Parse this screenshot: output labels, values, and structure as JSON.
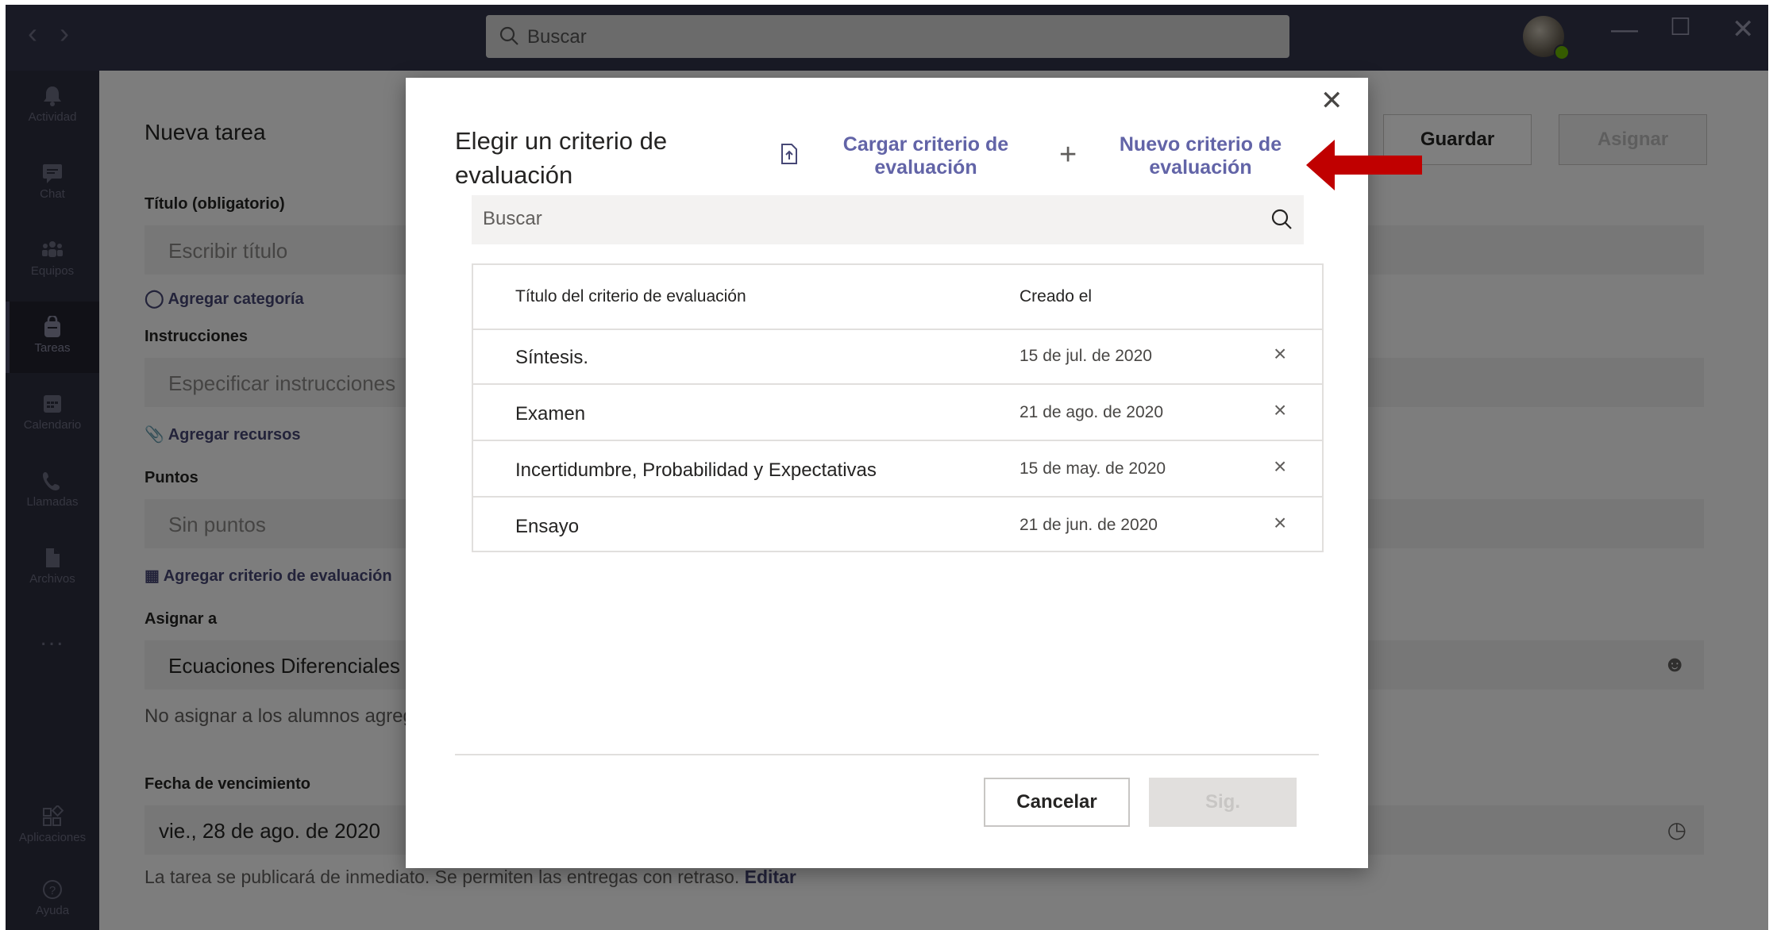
{
  "titlebar": {
    "search_placeholder": "Buscar"
  },
  "rail": {
    "items": [
      {
        "label": "Actividad",
        "icon": "bell-icon"
      },
      {
        "label": "Chat",
        "icon": "chat-icon"
      },
      {
        "label": "Equipos",
        "icon": "teams-icon"
      },
      {
        "label": "Tareas",
        "icon": "assignments-icon"
      },
      {
        "label": "Calendario",
        "icon": "calendar-icon"
      },
      {
        "label": "Llamadas",
        "icon": "phone-icon"
      },
      {
        "label": "Archivos",
        "icon": "files-icon"
      },
      {
        "label": "...",
        "icon": "more-icon"
      },
      {
        "label": "Aplicaciones",
        "icon": "apps-icon"
      },
      {
        "label": "Ayuda",
        "icon": "help-icon"
      }
    ]
  },
  "form": {
    "heading": "Nueva tarea",
    "save_label": "Guardar",
    "assign_label": "Asignar",
    "title_label": "Título (obligatorio)",
    "title_placeholder": "Escribir título",
    "add_category": "Agregar categoría",
    "instructions_label": "Instrucciones",
    "instructions_placeholder": "Especificar instrucciones",
    "add_resources": "Agregar recursos",
    "points_label": "Puntos",
    "points_value": "Sin puntos",
    "add_rubric": "Agregar criterio de evaluación",
    "assign_to_label": "Asignar a",
    "assign_to_value": "Ecuaciones Diferenciales y e",
    "no_assign_note": "No asignar a los alumnos agreg",
    "due_label": "Fecha de vencimiento",
    "due_value": "vie., 28 de ago. de 2020",
    "publish_note": "La tarea se publicará de inmediato. Se permiten las entregas con retraso.",
    "edit_link": "Editar"
  },
  "dialog": {
    "title": "Elegir un criterio de evaluación",
    "upload_label": "Cargar criterio de evaluación",
    "new_label": "Nuevo criterio de evaluación",
    "search_placeholder": "Buscar",
    "columns": [
      "Título del criterio de evaluación",
      "Creado el"
    ],
    "rows": [
      {
        "title": "Síntesis.",
        "created": "15 de jul. de 2020"
      },
      {
        "title": "Examen",
        "created": "21 de ago. de 2020"
      },
      {
        "title": "Incertidumbre, Probabilidad y Expectativas",
        "created": "15 de may. de 2020"
      },
      {
        "title": "Ensayo",
        "created": "21 de jun. de 2020"
      }
    ],
    "cancel_label": "Cancelar",
    "next_label": "Sig."
  },
  "colors": {
    "accent": "#6264a7",
    "titlebar": "#33344a",
    "rail": "#2d2e3f",
    "arrow": "#c00000"
  }
}
